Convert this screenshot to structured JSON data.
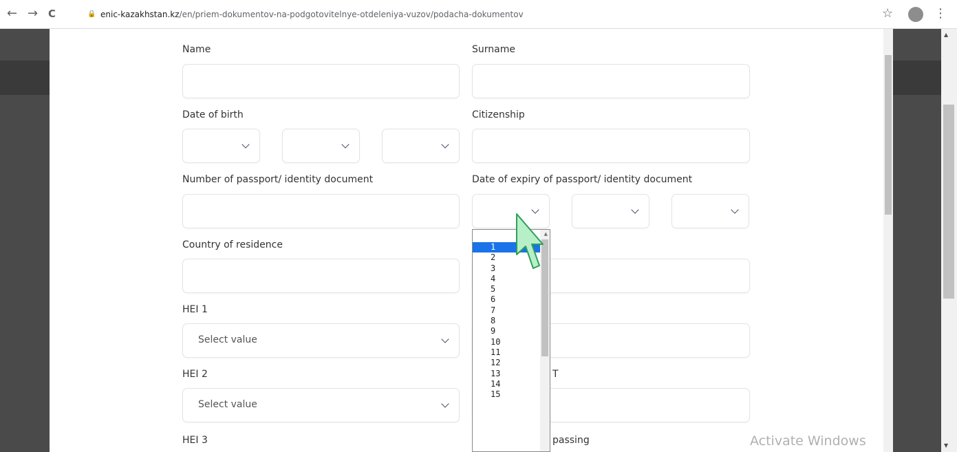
{
  "browser": {
    "back_icon": "←",
    "forward_icon": "→",
    "reload_icon": "C",
    "lock_icon": "🔒",
    "url_domain": "enic-kazakhstan.kz",
    "url_path": "/en/priem-dokumentov-na-podgotovitelnye-otdeleniya-vuzov/podacha-dokumentov",
    "star_icon": "☆",
    "menu_icon": "⋮"
  },
  "form": {
    "name_label": "Name",
    "surname_label": "Surname",
    "dob_label": "Date of birth",
    "citizenship_label": "Citizenship",
    "passport_number_label": "Number of passport/ identity document",
    "passport_expiry_label": "Date of expiry of passport/ identity document",
    "country_label": "Country of residence",
    "hei1_label": "HEI 1",
    "hei1_value": "Select value",
    "hei2_label": "HEI 2",
    "hei2_value": "Select value",
    "hei3_label": "HEI 3",
    "partial_label_1": "T",
    "partial_label_2": "passing"
  },
  "dropdown": {
    "options": [
      "1",
      "2",
      "3",
      "4",
      "5",
      "6",
      "7",
      "8",
      "9",
      "10",
      "11",
      "12",
      "13",
      "14",
      "15"
    ],
    "selected": "1"
  },
  "watermark": "Activate Windows",
  "colors": {
    "accent": "#1a73e8",
    "background_dark": "#4a4a4a",
    "cursor_fill": "#b7f0c8",
    "cursor_stroke": "#2e9e5a"
  }
}
